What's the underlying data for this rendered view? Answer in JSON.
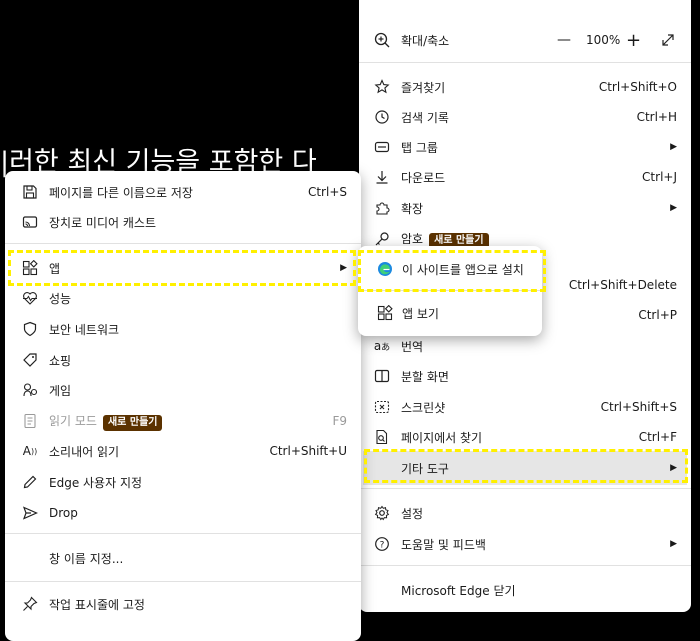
{
  "background": {
    "text": "|러한 최신 기능을 포함한 다"
  },
  "main_menu": {
    "zoom": {
      "label": "확대/축소",
      "minus": "—",
      "value": "100%",
      "plus": "+"
    },
    "items": [
      {
        "label": "즐겨찾기",
        "shortcut": "Ctrl+Shift+O"
      },
      {
        "label": "검색 기록",
        "shortcut": "Ctrl+H"
      },
      {
        "label": "탭 그룹",
        "chevron": "▶"
      },
      {
        "label": "다운로드",
        "shortcut": "Ctrl+J"
      },
      {
        "label": "확장",
        "chevron": "▶"
      },
      {
        "label": "암호",
        "badge": "새로 만들기"
      },
      {
        "label": "",
        "shortcut": "Ctrl+Shift+Delete"
      },
      {
        "label": "",
        "shortcut": "Ctrl+P"
      },
      {
        "label": "번역"
      },
      {
        "label": "분할 화면"
      },
      {
        "label": "스크린샷",
        "shortcut": "Ctrl+Shift+S"
      },
      {
        "label": "페이지에서 찾기",
        "shortcut": "Ctrl+F"
      },
      {
        "label": "기타 도구",
        "chevron": "▶"
      },
      {
        "label": "설정"
      },
      {
        "label": "도움말 및 피드백",
        "chevron": "▶"
      },
      {
        "label": "Microsoft Edge 닫기"
      }
    ]
  },
  "apps_menu": {
    "items": [
      {
        "label": "이 사이트를 앱으로 설치"
      },
      {
        "label": "앱 보기"
      }
    ]
  },
  "sub_menu": {
    "items": [
      {
        "label": "페이지를 다른 이름으로 저장",
        "shortcut": "Ctrl+S"
      },
      {
        "label": "장치로 미디어 캐스트"
      },
      {
        "label": "앱",
        "chevron": "▶"
      },
      {
        "label": "성능"
      },
      {
        "label": "보안 네트워크"
      },
      {
        "label": "쇼핑"
      },
      {
        "label": "게임"
      },
      {
        "label": "읽기 모드",
        "badge": "새로 만들기",
        "shortcut": "F9"
      },
      {
        "label": "소리내어 읽기",
        "shortcut": "Ctrl+Shift+U"
      },
      {
        "label": "Edge 사용자 지정"
      },
      {
        "label": "Drop"
      },
      {
        "label": "창 이름 지정..."
      },
      {
        "label": "작업 표시줄에 고정"
      }
    ]
  }
}
